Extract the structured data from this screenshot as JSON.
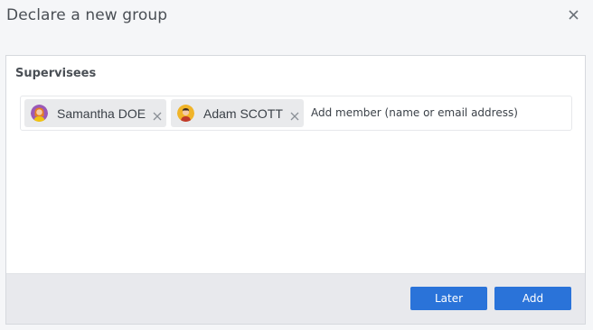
{
  "dialog": {
    "title": "Declare a new group"
  },
  "section": {
    "title": "Supervisees"
  },
  "members": [
    {
      "name": "Samantha DOE",
      "avatar": "female-avatar-icon",
      "avatar_color": "#9b59b6"
    },
    {
      "name": "Adam SCOTT",
      "avatar": "male-avatar-icon",
      "avatar_color": "#f0b429"
    }
  ],
  "member_input": {
    "placeholder": "Add member (name or email address)"
  },
  "footer": {
    "later_label": "Later",
    "add_label": "Add"
  },
  "colors": {
    "primary_button": "#2a73d9",
    "chip_background": "#e9eaec",
    "footer_background": "#e8e9ed"
  }
}
